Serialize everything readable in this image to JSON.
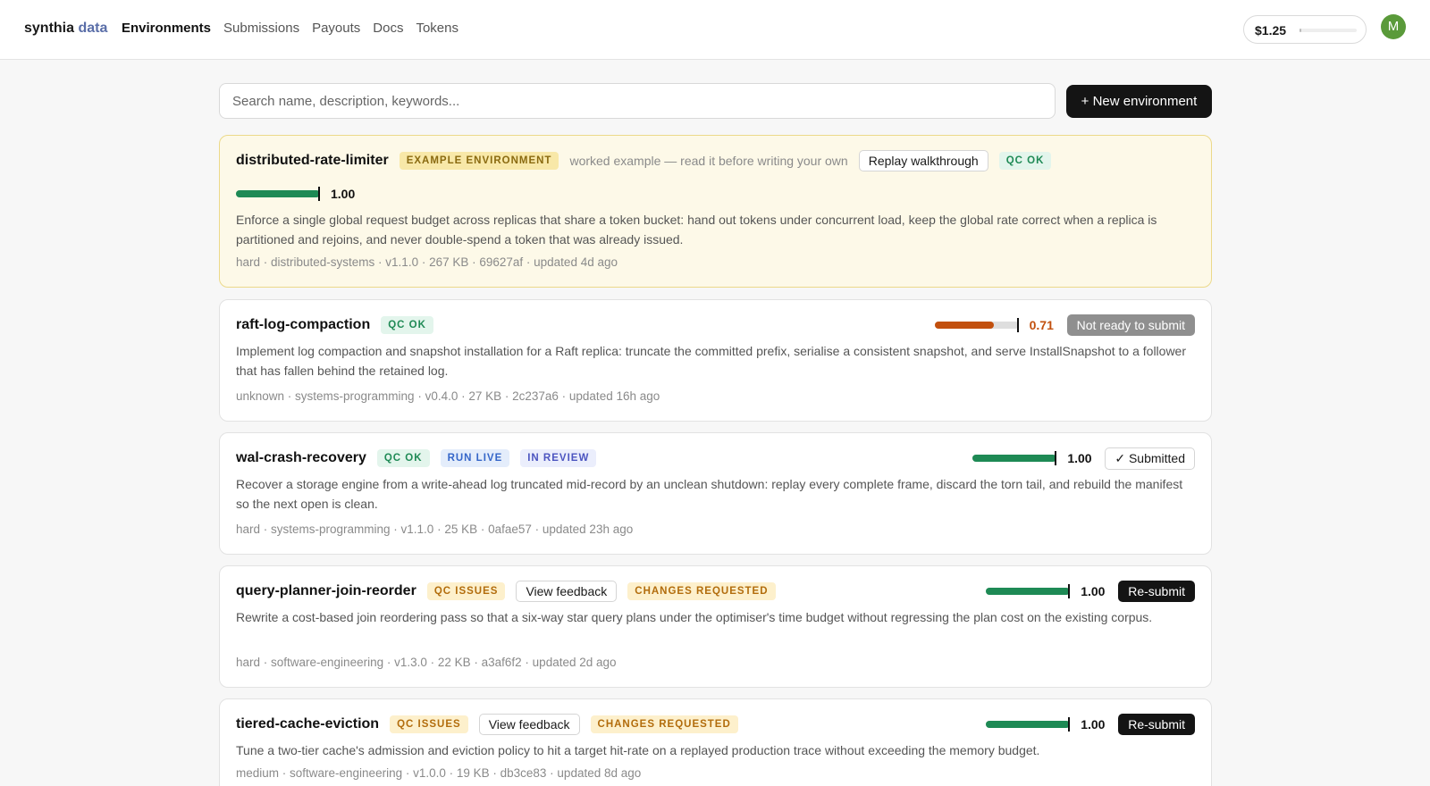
{
  "header": {
    "brand_main": "synthia",
    "brand_accent": "data",
    "nav": [
      "Environments",
      "Submissions",
      "Payouts",
      "Docs",
      "Tokens"
    ],
    "active_nav": "Environments",
    "balance": "$1.25",
    "balance_fraction": 0.03,
    "avatar_initial": "M"
  },
  "toolbar": {
    "search_placeholder": "Search name, description, keywords...",
    "new_button": "+ New environment"
  },
  "colors": {
    "score_good": "#1e8a55",
    "score_warn": "#c2500e",
    "score_warn_text": "#c2500e"
  },
  "environments": [
    {
      "name": "distributed-rate-limiter",
      "badges": [
        {
          "text": "EXAMPLE ENVIRONMENT",
          "kind": "example"
        }
      ],
      "note": "worked example — read it before writing your own",
      "walkthrough_button": "Replay walkthrough",
      "qc": "QC OK",
      "score": 1.0,
      "score_label": "1.00",
      "description": "Enforce a single global request budget across replicas that share a token bucket: hand out tokens under concurrent load, keep the global rate correct when a replica is partitioned and rejoins, and never double-spend a token that was already issued.",
      "meta": "hard · distributed-systems · v1.1.0 · 267 KB · 69627af · updated 4d ago"
    },
    {
      "name": "raft-log-compaction",
      "badges": [
        {
          "text": "QC OK",
          "kind": "ok"
        }
      ],
      "score": 0.71,
      "score_label": "0.71",
      "action": "Not ready to submit",
      "description": "Implement log compaction and snapshot installation for a Raft replica: truncate the committed prefix, serialise a consistent snapshot, and serve InstallSnapshot to a follower that has fallen behind the retained log.",
      "meta": "unknown · systems-programming · v0.4.0 · 27 KB · 2c237a6 · updated 16h ago"
    },
    {
      "name": "wal-crash-recovery",
      "badges": [
        {
          "text": "QC OK",
          "kind": "ok"
        },
        {
          "text": "RUN LIVE",
          "kind": "live"
        },
        {
          "text": "IN REVIEW",
          "kind": "review"
        }
      ],
      "score": 1.0,
      "score_label": "1.00",
      "action": "✓ Submitted",
      "description": "Recover a storage engine from a write-ahead log truncated mid-record by an unclean shutdown: replay every complete frame, discard the torn tail, and rebuild the manifest so the next open is clean.",
      "meta": "hard · systems-programming · v1.1.0 · 25 KB · 0afae57 · updated 23h ago"
    },
    {
      "name": "query-planner-join-reorder",
      "badges": [
        {
          "text": "QC ISSUES",
          "kind": "issues"
        },
        {
          "text": "CHANGES REQUESTED",
          "kind": "changes"
        }
      ],
      "feedback_button": "View feedback",
      "score": 1.0,
      "score_label": "1.00",
      "action": "Re-submit",
      "description": "Rewrite a cost-based join reordering pass so that a six-way star query plans under the optimiser's time budget without regressing the plan cost on the existing corpus.",
      "meta": "hard · software-engineering · v1.3.0 · 22 KB · a3af6f2 · updated 2d ago"
    },
    {
      "name": "tiered-cache-eviction",
      "badges": [
        {
          "text": "QC ISSUES",
          "kind": "issues"
        },
        {
          "text": "CHANGES REQUESTED",
          "kind": "changes"
        }
      ],
      "feedback_button": "View feedback",
      "score": 1.0,
      "score_label": "1.00",
      "action": "Re-submit",
      "description": "Tune a two-tier cache's admission and eviction policy to hit a target hit-rate on a replayed production trace without exceeding the memory budget.",
      "meta": "medium · software-engineering · v1.0.0 · 19 KB · db3ce83 · updated 8d ago"
    }
  ]
}
